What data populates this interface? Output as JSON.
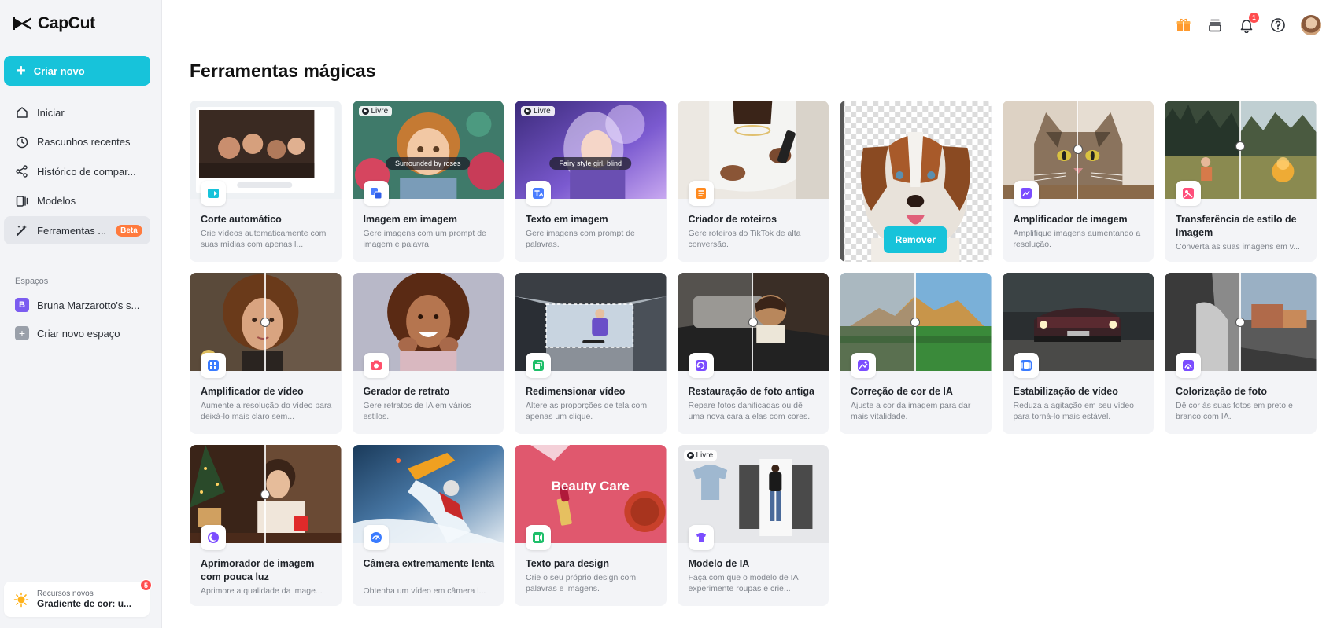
{
  "app": {
    "name": "CapCut"
  },
  "sidebar": {
    "create_label": "Criar novo",
    "nav": [
      {
        "label": "Iniciar",
        "icon": "home-icon"
      },
      {
        "label": "Rascunhos recentes",
        "icon": "clock-icon"
      },
      {
        "label": "Histórico de compar...",
        "icon": "share-icon"
      },
      {
        "label": "Modelos",
        "icon": "template-icon"
      },
      {
        "label": "Ferramentas ...",
        "icon": "magic-wand-icon",
        "badge": "Beta",
        "active": true
      }
    ],
    "spaces_label": "Espaços",
    "spaces": [
      {
        "avatar": "B",
        "label": "Bruna Marzarotto's s..."
      },
      {
        "avatar": "+",
        "label": "Criar novo espaço"
      }
    ],
    "news": {
      "small": "Recursos novos",
      "big": "Gradiente de cor: u...",
      "badge": "5"
    }
  },
  "header": {
    "bell_count": "1"
  },
  "main": {
    "title": "Ferramentas mágicas",
    "free_label": "Livre",
    "tools": [
      {
        "title": "Corte automático",
        "desc": "Crie vídeos automaticamente com suas mídias com apenas l..."
      },
      {
        "title": "Imagem em imagem",
        "desc": "Gere imagens com um prompt de imagem e palavra.",
        "caption": "Surrounded by roses"
      },
      {
        "title": "Texto em imagem",
        "desc": "Gere imagens com prompt de palavras.",
        "caption": "Fairy style girl, blind"
      },
      {
        "title": "Criador de roteiros",
        "desc": "Gere roteiros do TikTok de alta conversão."
      },
      {
        "remove_label": "Remover"
      },
      {
        "title": "Amplificador de imagem",
        "desc": "Amplifique imagens aumentando a resolução."
      },
      {
        "title": "Transferência de estilo de imagem",
        "desc": "Converta as suas imagens em v..."
      },
      {
        "title": "Amplificador de vídeo",
        "desc": "Aumente a resolução do vídeo para deixá-lo mais claro sem..."
      },
      {
        "title": "Gerador de retrato",
        "desc": "Gere retratos de IA em vários estilos."
      },
      {
        "title": "Redimensionar vídeo",
        "desc": "Altere as proporções de tela com apenas um clique."
      },
      {
        "title": "Restauração de foto antiga",
        "desc": "Repare fotos danificadas ou dê uma nova cara a elas com cores."
      },
      {
        "title": "Correção de cor de IA",
        "desc": "Ajuste a cor da imagem para dar mais vitalidade."
      },
      {
        "title": "Estabilização de vídeo",
        "desc": "Reduza a agitação em seu vídeo para torná-lo mais estável."
      },
      {
        "title": "Colorização de foto",
        "desc": "Dê cor às suas fotos em preto e branco com IA."
      },
      {
        "title": "Aprimorador de imagem com pouca luz",
        "desc": "Aprimore a qualidade da image..."
      },
      {
        "title": "Câmera extremamente lenta",
        "desc": "Obtenha um vídeo em câmera l..."
      },
      {
        "title": "Texto para design",
        "desc": "Crie o seu próprio design com palavras e imagens.",
        "caption": "Beauty Care"
      },
      {
        "title": "Modelo de IA",
        "desc": "Faça com que o modelo de IA experimente roupas e crie..."
      }
    ]
  },
  "colors": {
    "accent": "#17c3da",
    "beta": "#ff7a3d",
    "badge": "#ff4d4f",
    "icon_purple": "#7b4dff"
  }
}
